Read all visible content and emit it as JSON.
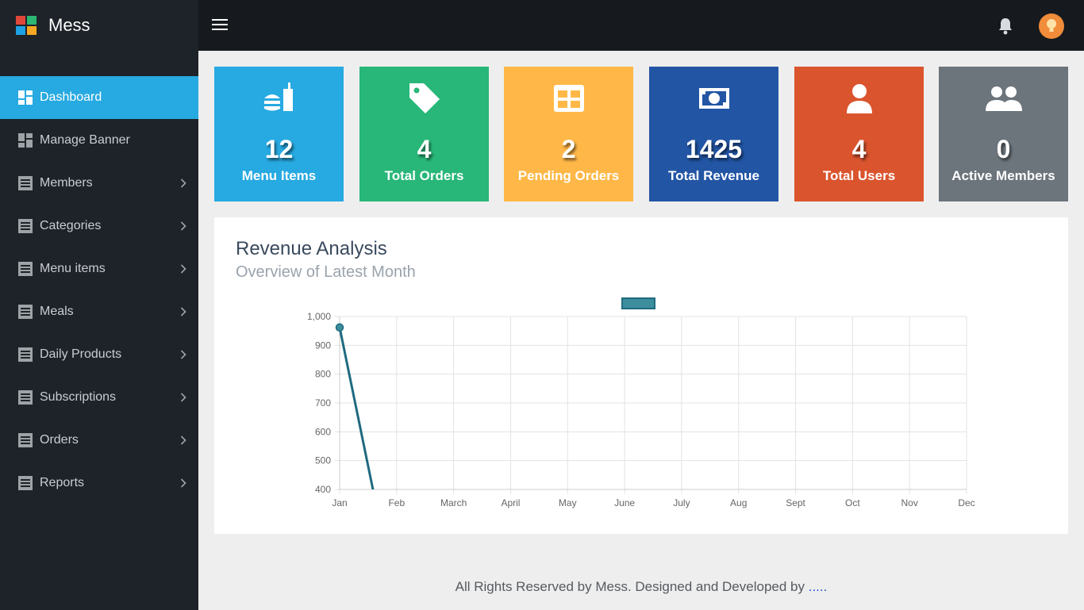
{
  "app": {
    "name": "Mess"
  },
  "sidebar": {
    "items": [
      {
        "label": "Dashboard",
        "icon": "dashboard-icon",
        "active": true,
        "has_children": false
      },
      {
        "label": "Manage Banner",
        "icon": "dashboard-icon",
        "active": false,
        "has_children": false
      },
      {
        "label": "Members",
        "icon": "list-icon",
        "active": false,
        "has_children": true
      },
      {
        "label": "Categories",
        "icon": "list-icon",
        "active": false,
        "has_children": true
      },
      {
        "label": "Menu items",
        "icon": "list-icon",
        "active": false,
        "has_children": true
      },
      {
        "label": "Meals",
        "icon": "list-icon",
        "active": false,
        "has_children": true
      },
      {
        "label": "Daily Products",
        "icon": "list-icon",
        "active": false,
        "has_children": true
      },
      {
        "label": "Subscriptions",
        "icon": "list-icon",
        "active": false,
        "has_children": true
      },
      {
        "label": "Orders",
        "icon": "list-icon",
        "active": false,
        "has_children": true
      },
      {
        "label": "Reports",
        "icon": "list-icon",
        "active": false,
        "has_children": true
      }
    ]
  },
  "header": {
    "menu_icon": "hamburger-icon",
    "bell_icon": "bell-icon",
    "avatar_icon": "avatar-icon"
  },
  "cards": [
    {
      "value": "12",
      "label": "Menu Items",
      "icon": "food-icon",
      "color": "#27a9e1"
    },
    {
      "value": "4",
      "label": "Total Orders",
      "icon": "tag-icon",
      "color": "#28b779"
    },
    {
      "value": "2",
      "label": "Pending Orders",
      "icon": "table-icon",
      "color": "#ffb848"
    },
    {
      "value": "1425",
      "label": "Total Revenue",
      "icon": "money-icon",
      "color": "#2255a4"
    },
    {
      "value": "4",
      "label": "Total Users",
      "icon": "user-icon",
      "color": "#da542e"
    },
    {
      "value": "0",
      "label": "Active Members",
      "icon": "users-icon",
      "color": "#6c747c"
    }
  ],
  "revenue": {
    "title": "Revenue Analysis",
    "subtitle": "Overview of Latest Month"
  },
  "chart_data": {
    "type": "line",
    "categories": [
      "Jan",
      "Feb",
      "March",
      "April",
      "May",
      "June",
      "July",
      "Aug",
      "Sept",
      "Oct",
      "Nov",
      "Dec"
    ],
    "series": [
      {
        "values": [
          962,
          0,
          null,
          null,
          null,
          null,
          null,
          null,
          null,
          null,
          null,
          null
        ],
        "color": "#1f6a80"
      }
    ],
    "yticks": [
      "1,000",
      "900",
      "800",
      "700",
      "600",
      "500",
      "400"
    ],
    "ylim": [
      400,
      1000
    ],
    "grid": true,
    "legend_position": "top-center"
  },
  "footer": {
    "text": "All Rights Reserved by Mess. Designed and Developed by",
    "link": "....."
  }
}
